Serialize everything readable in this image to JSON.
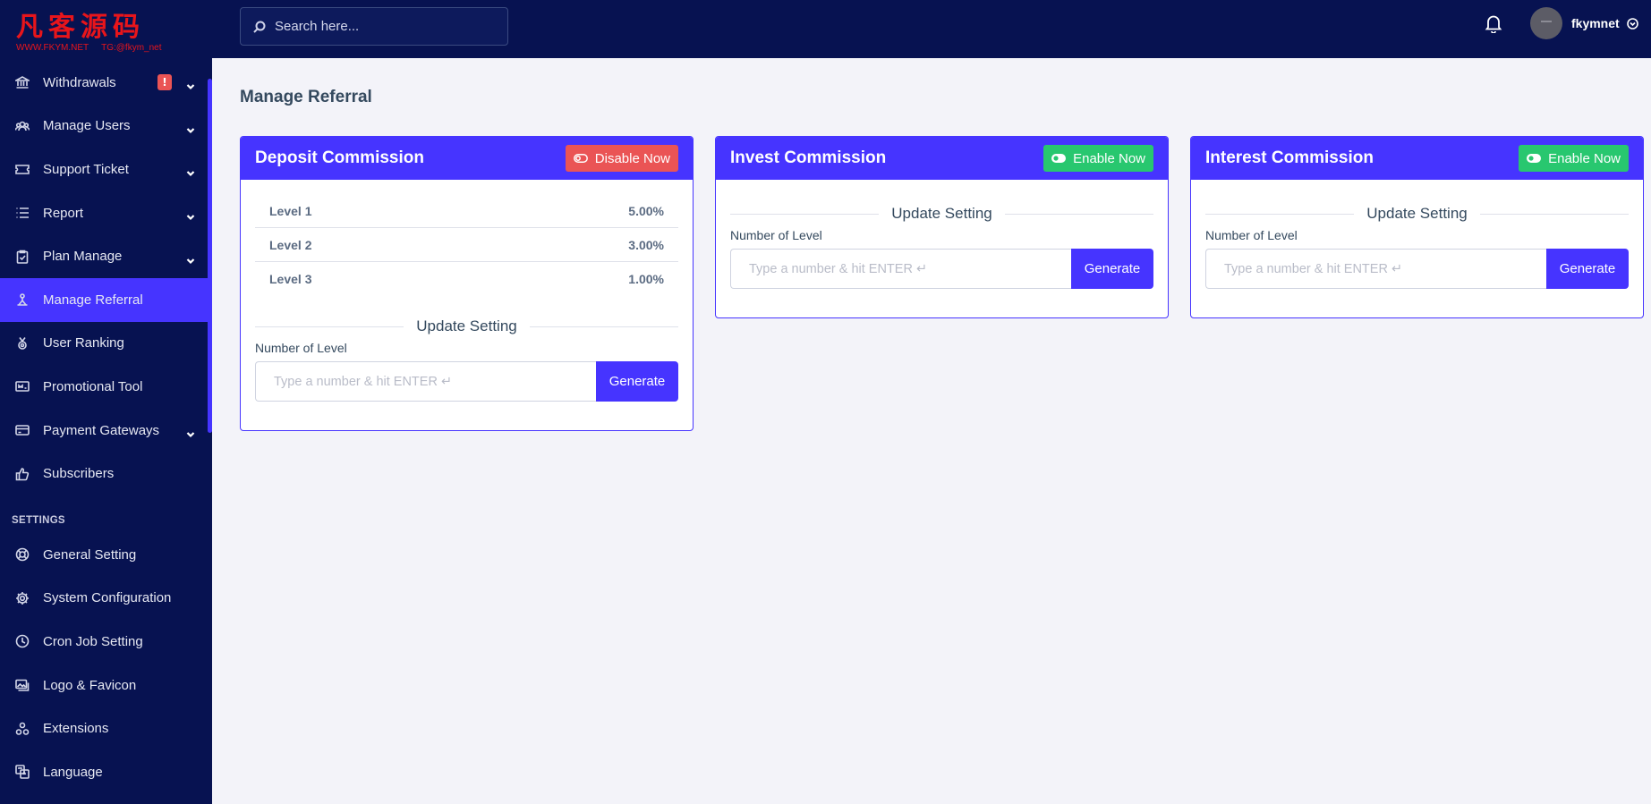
{
  "logo": {
    "chinese": "凡客源码",
    "site": "WWW.FKYM.NET",
    "tg": "TG:@fkym_net"
  },
  "sidebar": {
    "items": [
      {
        "label": "Withdrawals",
        "icon": "bank-icon",
        "has_children": true,
        "badge": "!"
      },
      {
        "label": "Manage Users",
        "icon": "users-icon",
        "has_children": true
      },
      {
        "label": "Support Ticket",
        "icon": "ticket-icon",
        "has_children": true
      },
      {
        "label": "Report",
        "icon": "list-icon",
        "has_children": true
      },
      {
        "label": "Plan Manage",
        "icon": "clipboard-icon",
        "has_children": true
      },
      {
        "label": "Manage Referral",
        "icon": "referral-icon",
        "has_children": false,
        "active": true
      },
      {
        "label": "User Ranking",
        "icon": "medal-icon",
        "has_children": false
      },
      {
        "label": "Promotional Tool",
        "icon": "promo-icon",
        "has_children": false
      },
      {
        "label": "Payment Gateways",
        "icon": "card-icon",
        "has_children": true
      },
      {
        "label": "Subscribers",
        "icon": "thumbs-up-icon",
        "has_children": false
      }
    ],
    "section_label": "SETTINGS",
    "settings_items": [
      {
        "label": "General Setting",
        "icon": "life-ring-icon"
      },
      {
        "label": "System Configuration",
        "icon": "gear-icon"
      },
      {
        "label": "Cron Job Setting",
        "icon": "clock-icon"
      },
      {
        "label": "Logo & Favicon",
        "icon": "images-icon"
      },
      {
        "label": "Extensions",
        "icon": "cubes-icon"
      },
      {
        "label": "Language",
        "icon": "language-icon"
      }
    ]
  },
  "topbar": {
    "search_placeholder": "Search here...",
    "username": "fkymnet"
  },
  "page": {
    "title": "Manage Referral"
  },
  "cards": [
    {
      "title": "Deposit Commission",
      "toggle_label": "Disable Now",
      "toggle_color": "#ea5455",
      "levels": [
        {
          "name": "Level 1",
          "value": "5.00%"
        },
        {
          "name": "Level 2",
          "value": "3.00%"
        },
        {
          "name": "Level 3",
          "value": "1.00%"
        }
      ],
      "section_title": "Update Setting",
      "field_label": "Number of Level",
      "input_placeholder": "Type a number & hit ENTER ↵",
      "button_label": "Generate"
    },
    {
      "title": "Invest Commission",
      "toggle_label": "Enable Now",
      "toggle_color": "#28c76f",
      "levels": [],
      "section_title": "Update Setting",
      "field_label": "Number of Level",
      "input_placeholder": "Type a number & hit ENTER ↵",
      "button_label": "Generate"
    },
    {
      "title": "Interest Commission",
      "toggle_label": "Enable Now",
      "toggle_color": "#28c76f",
      "levels": [],
      "section_title": "Update Setting",
      "field_label": "Number of Level",
      "input_placeholder": "Type a number & hit ENTER ↵",
      "button_label": "Generate"
    }
  ],
  "colors": {
    "sidebar": "#071251",
    "accent": "#4634ff",
    "danger": "#ea5455",
    "success": "#28c76f",
    "background": "#f3f3f9"
  }
}
